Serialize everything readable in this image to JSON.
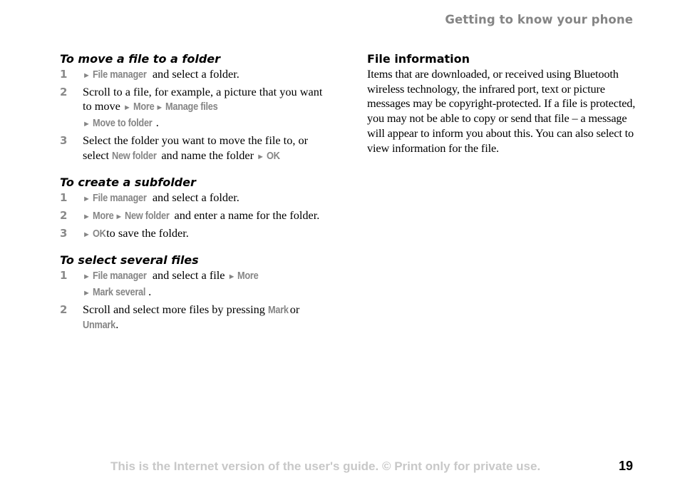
{
  "header": {
    "chapter": "Getting to know your phone"
  },
  "left": {
    "sections": [
      {
        "title": "To move a file to a folder",
        "steps": [
          {
            "num": "1",
            "parts": [
              [
                "arrow",
                "►"
              ],
              [
                "k",
                "File manager"
              ],
              [
                "t",
                " and select a folder."
              ]
            ]
          },
          {
            "num": "2",
            "parts": [
              [
                "t",
                "Scroll to a file, for example, a picture that you want to move "
              ],
              [
                "arrow",
                "►"
              ],
              [
                "k",
                "More"
              ],
              [
                "t",
                " "
              ],
              [
                "arrow",
                "►"
              ],
              [
                "k",
                "Manage files"
              ],
              [
                "br",
                ""
              ],
              [
                "arrow",
                "►"
              ],
              [
                "k",
                "Move to folder"
              ],
              [
                "t",
                "."
              ]
            ]
          },
          {
            "num": "3",
            "parts": [
              [
                "t",
                "Select the folder you want to move the file to, or select "
              ],
              [
                "k",
                "New folder"
              ],
              [
                "t",
                " and name the folder "
              ],
              [
                "arrow",
                "►"
              ],
              [
                "k",
                "OK"
              ],
              [
                "t",
                "."
              ]
            ]
          }
        ]
      },
      {
        "title": "To create a subfolder",
        "steps": [
          {
            "num": "1",
            "parts": [
              [
                "arrow",
                "►"
              ],
              [
                "k",
                "File manager"
              ],
              [
                "t",
                " and select a folder."
              ]
            ]
          },
          {
            "num": "2",
            "parts": [
              [
                "arrow",
                "►"
              ],
              [
                "k",
                "More"
              ],
              [
                "t",
                " "
              ],
              [
                "arrow",
                "►"
              ],
              [
                "k",
                "New folder"
              ],
              [
                "t",
                " and enter a name for the folder."
              ]
            ]
          },
          {
            "num": "3",
            "parts": [
              [
                "arrow",
                "►"
              ],
              [
                "k",
                "OK"
              ],
              [
                "t",
                " to save the folder."
              ]
            ]
          }
        ]
      },
      {
        "title": "To select several files",
        "steps": [
          {
            "num": "1",
            "parts": [
              [
                "arrow",
                "►"
              ],
              [
                "k",
                "File manager"
              ],
              [
                "t",
                " and select a file "
              ],
              [
                "arrow",
                "►"
              ],
              [
                "k",
                "More"
              ],
              [
                "br",
                ""
              ],
              [
                "arrow",
                "►"
              ],
              [
                "k",
                "Mark several"
              ],
              [
                "t",
                "."
              ]
            ]
          },
          {
            "num": "2",
            "parts": [
              [
                "t",
                "Scroll and select more files by pressing "
              ],
              [
                "k",
                "Mark"
              ],
              [
                "t",
                " or "
              ],
              [
                "br",
                ""
              ],
              [
                "k",
                "Unmark"
              ],
              [
                "t",
                "."
              ]
            ]
          }
        ]
      }
    ]
  },
  "right": {
    "title": "File information",
    "body": "Items that are downloaded, or received using Bluetooth wireless technology, the infrared port, text or picture messages may be copyright-protected. If a file is protected, you may not be able to copy or send that file – a message will appear to inform you about this. You can also select to view information for the file."
  },
  "footer": {
    "notice": "This is the Internet version of the user's guide. © Print only for private use.",
    "page_number": "19"
  }
}
